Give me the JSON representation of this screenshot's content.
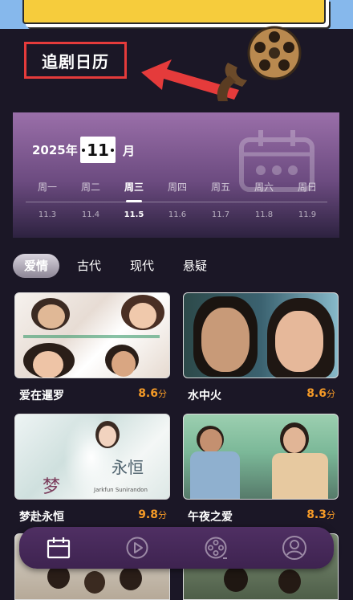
{
  "header": {
    "title": "追剧日历"
  },
  "calendar": {
    "year": "2025年",
    "month": "11",
    "month_unit": "月",
    "weekdays": [
      "周一",
      "周二",
      "周三",
      "周四",
      "周五",
      "周六",
      "周日"
    ],
    "dates": [
      "11.3",
      "11.4",
      "11.5",
      "11.6",
      "11.7",
      "11.8",
      "11.9"
    ],
    "selected_index": 2
  },
  "genres": {
    "items": [
      "爱情",
      "古代",
      "现代",
      "悬疑"
    ],
    "selected": "爱情"
  },
  "dramas": [
    {
      "name": "爱在暹罗",
      "score": "8.6",
      "unit": "分"
    },
    {
      "name": "水中火",
      "score": "8.6",
      "unit": "分"
    },
    {
      "name": "梦赴永恒",
      "score": "9.8",
      "unit": "分"
    },
    {
      "name": "午夜之爱",
      "score": "8.3",
      "unit": "分"
    }
  ],
  "bottom_nav": {
    "items": [
      "calendar-icon",
      "play-circle-icon",
      "film-reel-icon",
      "profile-icon"
    ],
    "active_index": 0
  },
  "colors": {
    "score": "#f59a27",
    "accent_red": "#e53b3b",
    "nav_bg": "#4f2f63"
  }
}
